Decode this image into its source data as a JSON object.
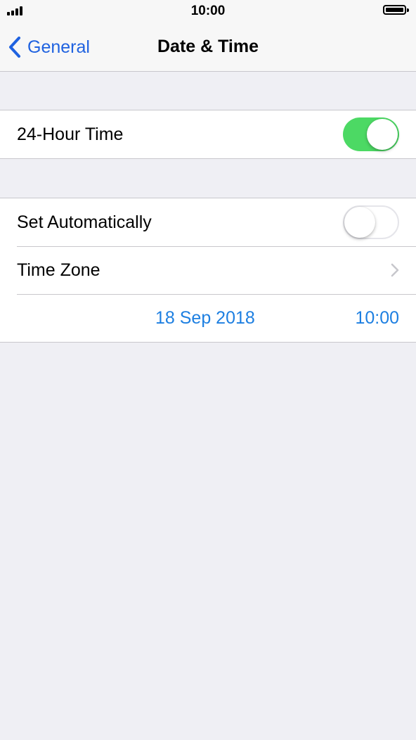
{
  "status_bar": {
    "time": "10:00",
    "signal_icon": "cellular-signal-icon",
    "battery_icon": "battery-icon",
    "battery_level": 1.0
  },
  "nav": {
    "back_label": "General",
    "back_icon": "chevron-left-icon",
    "title": "Date & Time"
  },
  "groups": [
    {
      "rows": [
        {
          "label": "24-Hour Time",
          "toggle_on": true
        }
      ]
    },
    {
      "rows": [
        {
          "label": "Set Automatically",
          "toggle_on": false
        },
        {
          "label": "Time Zone",
          "accessory": "chevron-right-icon"
        }
      ],
      "datetime": {
        "date": "18 Sep 2018",
        "time": "10:00"
      }
    }
  ],
  "colors": {
    "accent_blue": "#1f62e0",
    "value_blue": "#1d7fe1",
    "toggle_on_green": "#4cd964",
    "background": "#efeff4",
    "separator": "#c8c7cc"
  }
}
